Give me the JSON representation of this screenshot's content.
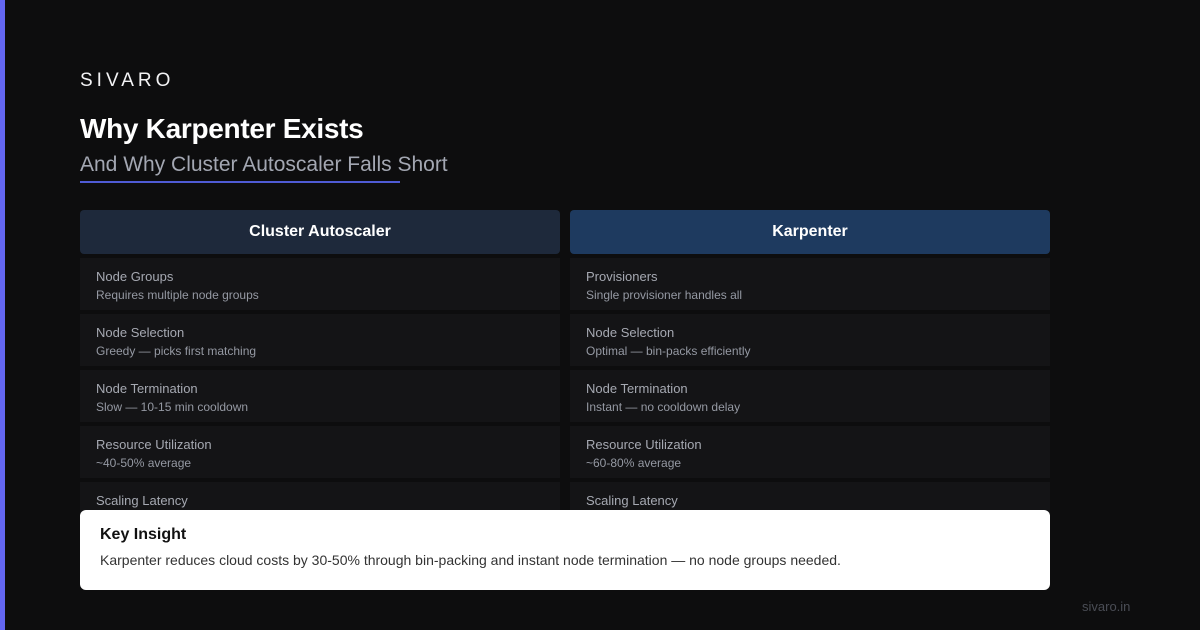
{
  "colors": {
    "accent": "#6366f1",
    "underline": "#4f5bd5"
  },
  "brand": "SIVARO",
  "title": "Why Karpenter Exists",
  "subtitle": "And Why Cluster Autoscaler Falls Short",
  "columns": [
    {
      "header": "Cluster Autoscaler",
      "rows": [
        {
          "label": "Node Groups",
          "value": "Requires multiple node groups"
        },
        {
          "label": "Node Selection",
          "value": "Greedy — picks first matching"
        },
        {
          "label": "Node Termination",
          "value": "Slow — 10-15 min cooldown"
        },
        {
          "label": "Resource Utilization",
          "value": "~40-50% average"
        },
        {
          "label": "Scaling Latency",
          "value": ""
        }
      ]
    },
    {
      "header": "Karpenter",
      "rows": [
        {
          "label": "Provisioners",
          "value": "Single provisioner handles all"
        },
        {
          "label": "Node Selection",
          "value": "Optimal — bin-packs efficiently"
        },
        {
          "label": "Node Termination",
          "value": "Instant — no cooldown delay"
        },
        {
          "label": "Resource Utilization",
          "value": "~60-80% average"
        },
        {
          "label": "Scaling Latency",
          "value": ""
        }
      ]
    }
  ],
  "insight": {
    "title": "Key Insight",
    "text": "Karpenter reduces cloud costs by 30-50% through bin-packing and instant node termination — no node groups needed."
  },
  "footer": "sivaro.in"
}
